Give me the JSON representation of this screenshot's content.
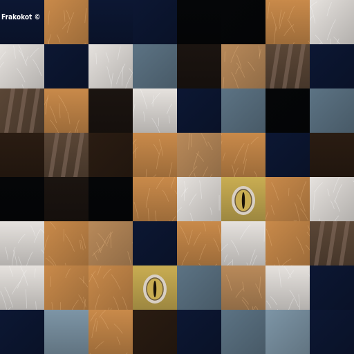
{
  "game": {
    "type": "sliding-tile-picture-puzzle",
    "grid_rows": 8,
    "grid_cols": 8,
    "watermark": "Frakokot ©"
  },
  "palette": {
    "navy": "#0c1733",
    "navy2": "#111c38",
    "black": "#050608",
    "dark": "#1b1410",
    "darkbrown": "#2a1c12",
    "orange": "#c98a4a",
    "orange2": "#d59a56",
    "tan": "#b98a5a",
    "white": "#e6e2de",
    "grey": "#5c7384",
    "greyblue": "#7d95a6",
    "brownwall": "#5a4636",
    "eye": "#c9ad52"
  },
  "tiles": [
    [
      "navy",
      "orange",
      "navy",
      "navy",
      "black",
      "black",
      "orange",
      "white"
    ],
    [
      "white",
      "navy",
      "white",
      "grey",
      "dark",
      "tan",
      "brownwall",
      "navy"
    ],
    [
      "brownwall",
      "orange",
      "dark",
      "white",
      "navy",
      "grey",
      "black",
      "grey"
    ],
    [
      "darkbrown",
      "brownwall",
      "darkbrown",
      "orange",
      "tan",
      "orange",
      "navy",
      "darkbrown"
    ],
    [
      "black",
      "dark",
      "black",
      "orange",
      "white",
      "eye",
      "orange",
      "white"
    ],
    [
      "white",
      "orange",
      "tan",
      "navy",
      "orange",
      "white",
      "orange",
      "brownwall"
    ],
    [
      "white",
      "orange",
      "orange",
      "eye",
      "grey",
      "tan",
      "white",
      "navy"
    ],
    [
      "navy",
      "greyblue",
      "orange",
      "darkbrown",
      "navy",
      "grey",
      "greyblue",
      "navy"
    ]
  ]
}
